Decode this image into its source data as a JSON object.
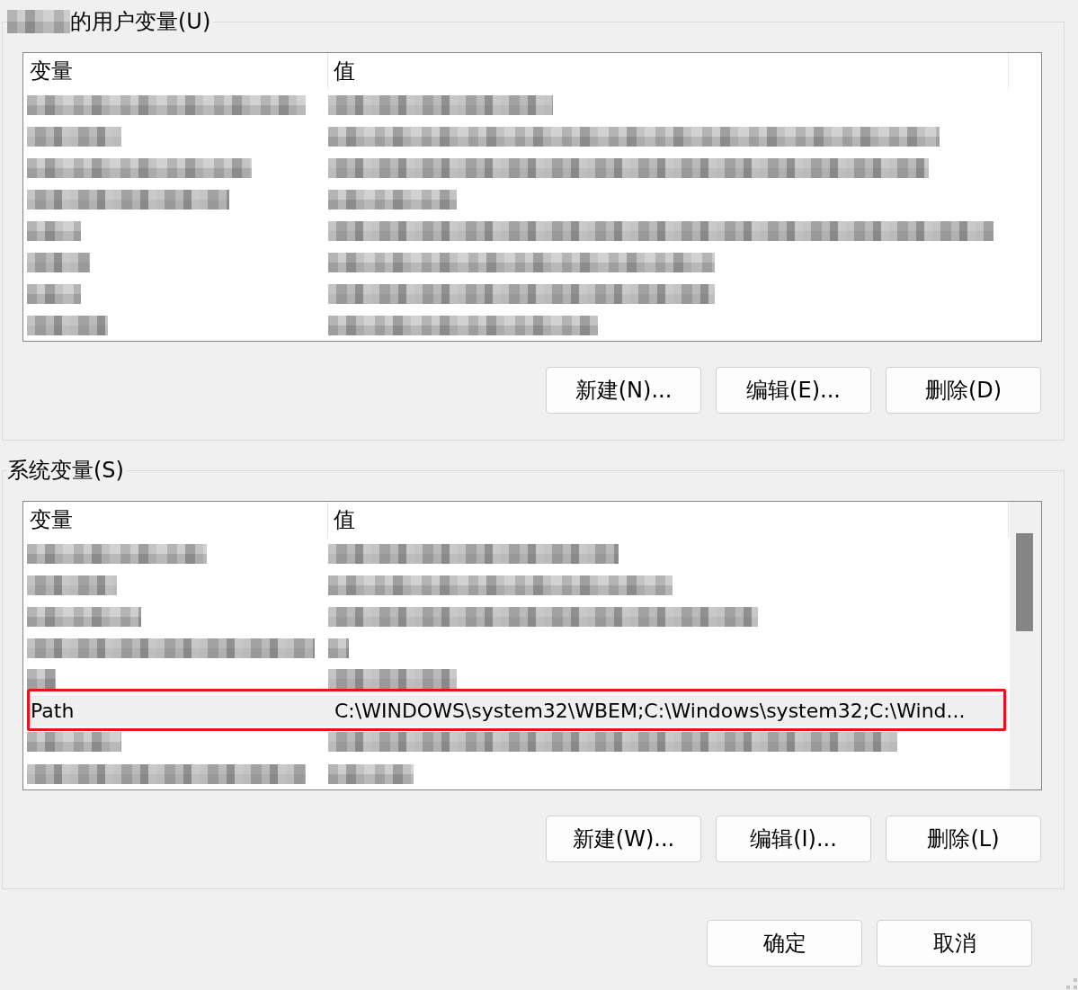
{
  "user_variables": {
    "title": {
      "prefix_redacted": true,
      "text": "的用户变量(U)"
    },
    "columns": [
      "变量",
      "值"
    ],
    "scrollbar": false,
    "rows": [
      {
        "kind": "redacted",
        "selected": false,
        "outlined": false
      },
      {
        "kind": "redacted",
        "selected": false,
        "outlined": false
      },
      {
        "kind": "redacted",
        "selected": false,
        "outlined": false
      },
      {
        "kind": "redacted",
        "selected": false,
        "outlined": false
      },
      {
        "kind": "redacted",
        "selected": false,
        "outlined": false
      },
      {
        "kind": "redacted",
        "selected": false,
        "outlined": false
      },
      {
        "kind": "redacted",
        "selected": false,
        "outlined": false
      },
      {
        "kind": "redacted",
        "selected": false,
        "outlined": false
      }
    ],
    "buttons": [
      "新建(N)...",
      "编辑(E)...",
      "删除(D)"
    ]
  },
  "system_variables": {
    "title": {
      "prefix_redacted": false,
      "text": "系统变量(S)"
    },
    "columns": [
      "变量",
      "值"
    ],
    "scrollbar": true,
    "rows": [
      {
        "kind": "redacted",
        "selected": false,
        "outlined": false
      },
      {
        "kind": "redacted",
        "selected": false,
        "outlined": false
      },
      {
        "kind": "redacted",
        "selected": false,
        "outlined": false
      },
      {
        "kind": "redacted",
        "selected": false,
        "outlined": false
      },
      {
        "kind": "redacted",
        "selected": false,
        "outlined": false
      },
      {
        "kind": "text",
        "name": "Path",
        "value": "C:\\WINDOWS\\system32\\WBEM;C:\\Windows\\system32;C:\\Wind...",
        "selected": true,
        "outlined": true
      },
      {
        "kind": "redacted",
        "selected": false,
        "outlined": false
      },
      {
        "kind": "redacted",
        "selected": false,
        "outlined": false
      }
    ],
    "buttons": [
      "新建(W)...",
      "编辑(I)...",
      "删除(L)"
    ]
  },
  "dialog_buttons": [
    "确定",
    "取消"
  ]
}
